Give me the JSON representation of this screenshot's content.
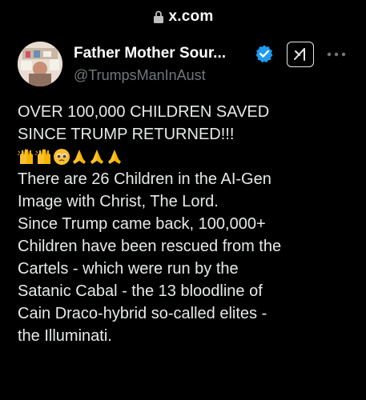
{
  "browser": {
    "url": "x.com",
    "lock_icon": "lock-icon"
  },
  "tweet": {
    "author": {
      "display_name": "Father Mother Sour...",
      "handle": "@TrumpsManInAust",
      "verified_color": "#1d9bf0",
      "verified_icon": "verified-badge-icon"
    },
    "grok_button_icon": "grok-icon",
    "more_icon": "more-options-icon",
    "text_lines": [
      "OVER 100,000 CHILDREN SAVED",
      "SINCE TRUMP RETURNED!!!"
    ],
    "emojis": [
      "raising-hands-icon",
      "raising-hands-icon",
      "pleading-face-icon",
      "folded-hands-icon",
      "folded-hands-icon",
      "folded-hands-icon"
    ],
    "body_lines": [
      "There are 26 Children in the AI-Gen",
      "Image with Christ, The Lord.",
      "Since Trump came back, 100,000+",
      "Children have been rescued from the",
      "Cartels - which were run by the",
      "Satanic Cabal - the 13 bloodline of",
      "Cain Draco-hybrid so-called elites  -",
      "the Illuminati."
    ]
  },
  "colors": {
    "background": "#000000",
    "text": "#e7e9ea",
    "secondary_text": "#71767b",
    "emoji_yellow": "#fbc02d",
    "emoji_orange": "#f59e0b"
  }
}
